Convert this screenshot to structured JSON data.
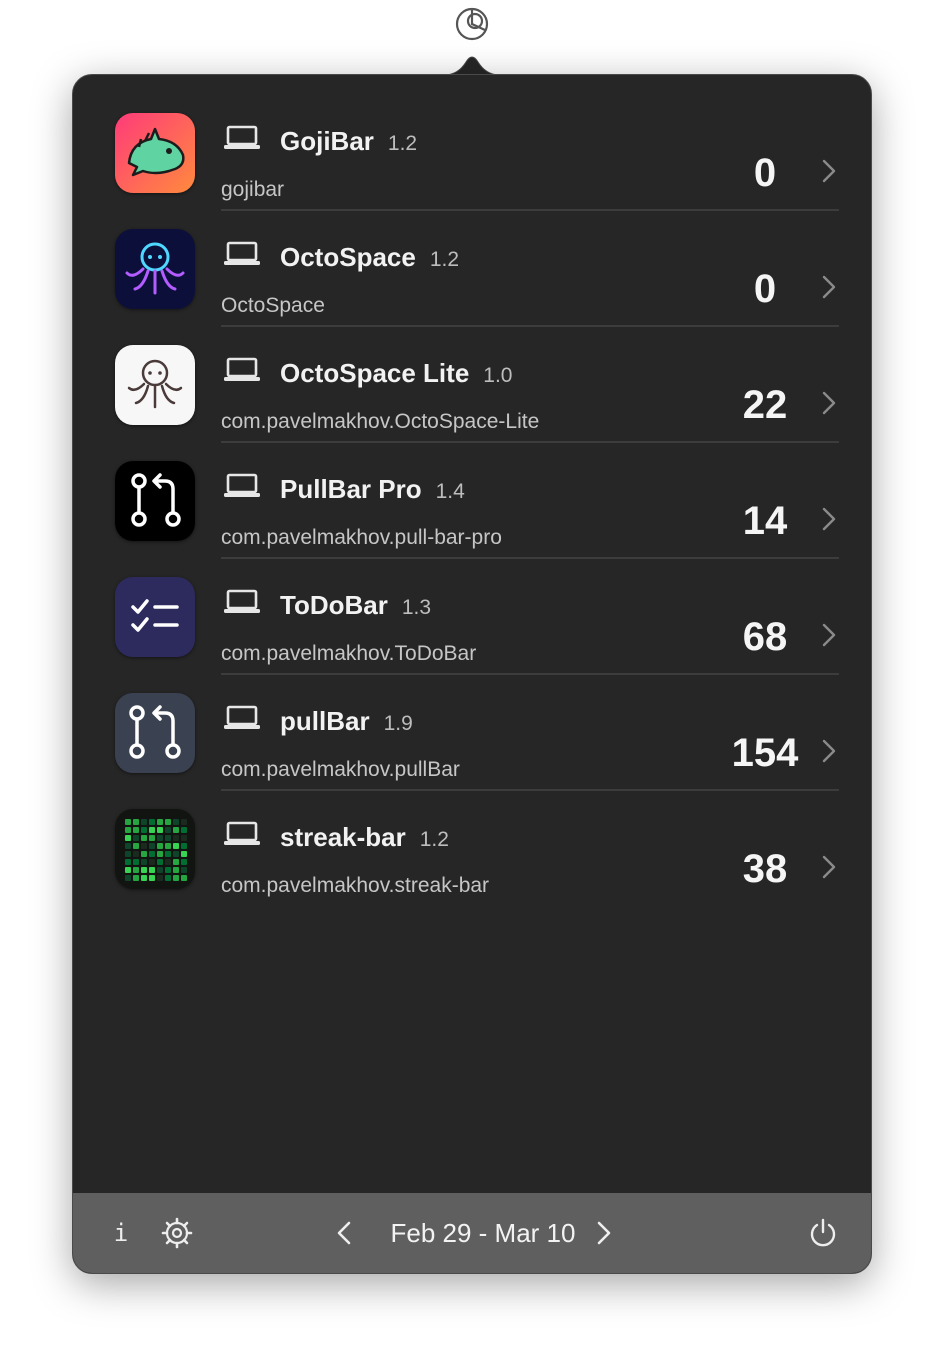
{
  "menubar": {
    "icon": "pie-chart-icon"
  },
  "apps": [
    {
      "name": "GojiBar",
      "version": "1.2",
      "bundle_id": "gojibar",
      "count": "0",
      "icon": "dinosaur-icon",
      "device_icon": "laptop-icon"
    },
    {
      "name": "OctoSpace",
      "version": "1.2",
      "bundle_id": "OctoSpace",
      "count": "0",
      "icon": "octopus-icon",
      "device_icon": "laptop-icon"
    },
    {
      "name": "OctoSpace Lite",
      "version": "1.0",
      "bundle_id": "com.pavelmakhov.OctoSpace-Lite",
      "count": "22",
      "icon": "octopus-outline-icon",
      "device_icon": "laptop-icon"
    },
    {
      "name": "PullBar Pro",
      "version": "1.4",
      "bundle_id": "com.pavelmakhov.pull-bar-pro",
      "count": "14",
      "icon": "pull-request-icon",
      "device_icon": "laptop-icon"
    },
    {
      "name": "ToDoBar",
      "version": "1.3",
      "bundle_id": "com.pavelmakhov.ToDoBar",
      "count": "68",
      "icon": "checklist-icon",
      "device_icon": "laptop-icon"
    },
    {
      "name": "pullBar",
      "version": "1.9",
      "bundle_id": "com.pavelmakhov.pullBar",
      "count": "154",
      "icon": "pull-request-icon",
      "device_icon": "laptop-icon"
    },
    {
      "name": "streak-bar",
      "version": "1.2",
      "bundle_id": "com.pavelmakhov.streak-bar",
      "count": "38",
      "icon": "contribution-grid-icon",
      "device_icon": "laptop-icon"
    }
  ],
  "footer": {
    "info_label": "i",
    "date_range": "Feb 29  -  Mar 10",
    "icons": [
      "info-icon",
      "gear-icon",
      "chevron-left-icon",
      "chevron-right-icon",
      "power-icon"
    ]
  },
  "colors": {
    "panel_background": "#262626",
    "footer_background": "#5f5f5f",
    "divider": "#3c3c3c",
    "text_primary": "#f2f2f2",
    "text_secondary": "#c6c6c6"
  }
}
